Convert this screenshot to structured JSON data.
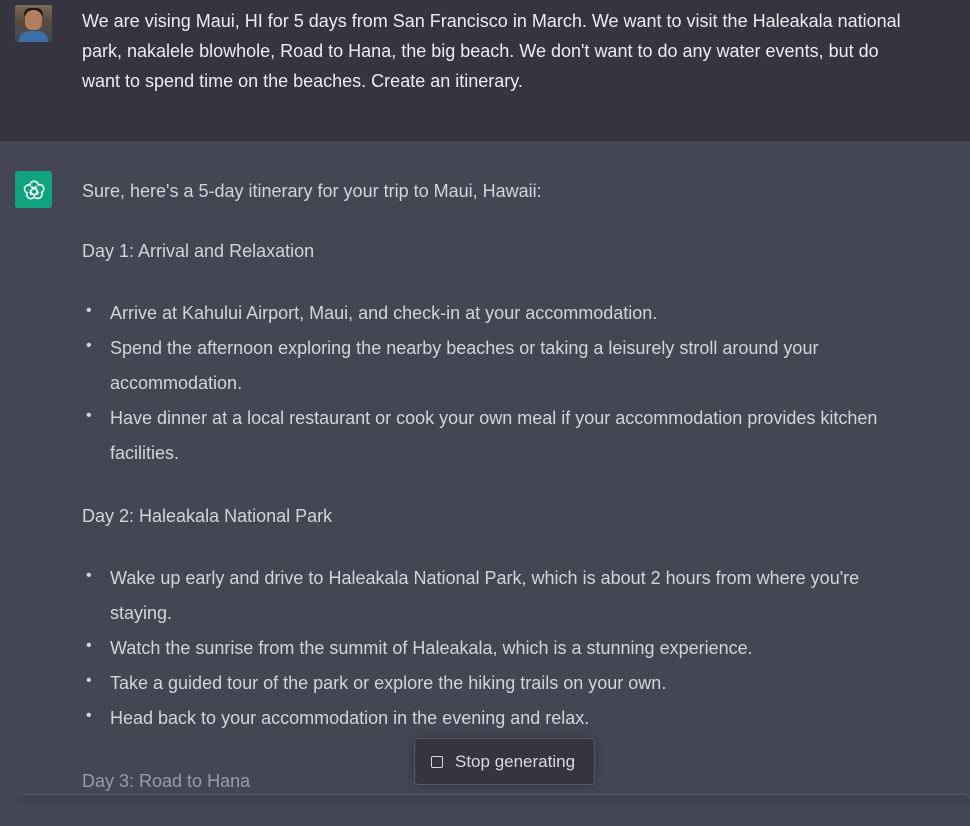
{
  "user_message": {
    "text": "We are vising Maui, HI for 5 days from San Francisco in March. We want to visit the Haleakala national park, nakalele blowhole, Road to Hana, the big beach. We don't want to do any water events, but do want to spend time on the beaches. Create an itinerary."
  },
  "assistant_message": {
    "intro": "Sure, here's a 5-day itinerary for your trip to Maui, Hawaii:",
    "days": [
      {
        "title": "Day 1: Arrival and Relaxation",
        "items": [
          "Arrive at Kahului Airport, Maui, and check-in at your accommodation.",
          "Spend the afternoon exploring the nearby beaches or taking a leisurely stroll around your accommodation.",
          "Have dinner at a local restaurant or cook your own meal if your accommodation provides kitchen facilities."
        ]
      },
      {
        "title": "Day 2: Haleakala National Park",
        "items": [
          "Wake up early and drive to Haleakala National Park, which is about 2 hours from where you're staying.",
          "Watch the sunrise from the summit of Haleakala, which is a stunning experience.",
          "Take a guided tour of the park or explore the hiking trails on your own.",
          "Head back to your accommodation in the evening and relax."
        ]
      },
      {
        "title": "Day 3: Road to Hana",
        "items": []
      }
    ]
  },
  "controls": {
    "stop_label": "Stop generating"
  },
  "colors": {
    "user_bg": "#343541",
    "assistant_bg": "#444654",
    "brand_green": "#10a37f"
  },
  "icons": {
    "user": "user-avatar",
    "assistant": "openai-logo-icon",
    "stop": "stop-square-icon"
  }
}
